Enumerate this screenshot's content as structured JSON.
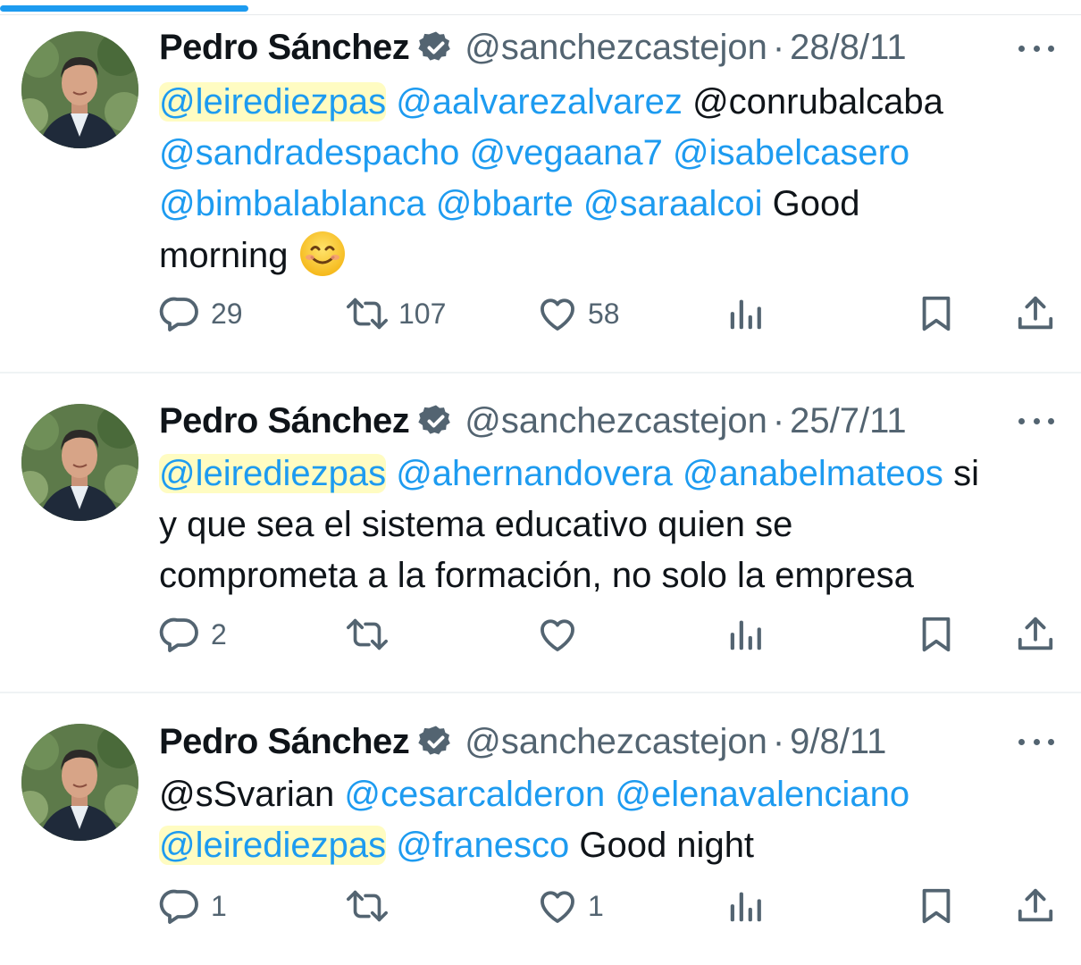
{
  "colors": {
    "accent": "#1d9bf0",
    "text": "#0f1419",
    "muted": "#536471",
    "highlight": "#fff878"
  },
  "tweets": [
    {
      "author": "Pedro Sánchez",
      "handle": "@sanchezcastejon",
      "separator": "·",
      "date": "28/8/11",
      "mentions": [
        "@leirediezpas",
        "@aalvarezalvarez"
      ],
      "text_a": "@conrubalcaba",
      "mentions_b": [
        "@sandradespacho",
        "@vegaana7",
        "@isabelcasero",
        "@bimbalablanca",
        "@bbarte",
        "@saraalcoi"
      ],
      "text_b": "Good",
      "text_c": "morning",
      "emoji": "smiling-face-emoji",
      "replies": "29",
      "retweets": "107",
      "likes": "58"
    },
    {
      "author": "Pedro Sánchez",
      "handle": "@sanchezcastejon",
      "separator": "·",
      "date": "25/7/11",
      "mentions": [
        "@leirediezpas",
        "@ahernandovera",
        "@anabelmateos"
      ],
      "text_a": "si",
      "text_b": "y que sea el sistema educativo quien se",
      "text_c": "comprometa a la formación, no solo la empresa",
      "replies": "2",
      "retweets": "",
      "likes": ""
    },
    {
      "author": "Pedro Sánchez",
      "handle": "@sanchezcastejon",
      "separator": "·",
      "date": "9/8/11",
      "text_a": "@sSvarian",
      "mentions": [
        "@cesarcalderon",
        "@elenavalenciano",
        "@leirediezpas",
        "@franesco"
      ],
      "text_b": "Good night",
      "replies": "1",
      "retweets": "",
      "likes": "1"
    }
  ],
  "loading_progress": 0.23,
  "icons": [
    "verified-badge-icon",
    "more-icon",
    "reply-icon",
    "retweet-icon",
    "like-icon",
    "views-icon",
    "bookmark-icon",
    "share-icon"
  ]
}
